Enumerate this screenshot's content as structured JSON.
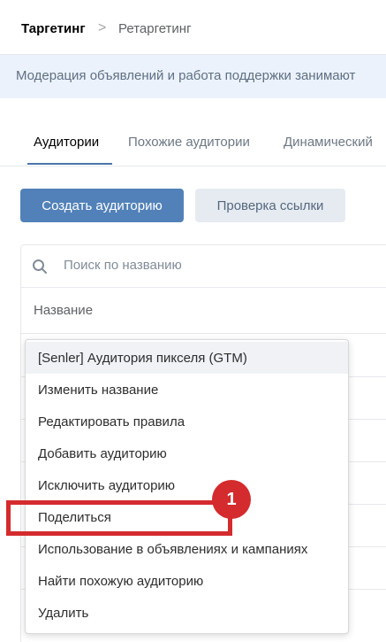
{
  "breadcrumb": {
    "items": [
      "Таргетинг",
      "Ретаргетинг"
    ],
    "separator": ">"
  },
  "notice": {
    "text": "Модерация объявлений и работа поддержки занимают"
  },
  "tabs": [
    {
      "label": "Аудитории",
      "active": true
    },
    {
      "label": "Похожие аудитории",
      "active": false
    },
    {
      "label": "Динамический",
      "active": false
    }
  ],
  "buttons": {
    "create": "Создать аудиторию",
    "check_link": "Проверка ссылки"
  },
  "search": {
    "placeholder": "Поиск по названию",
    "icon": "search-icon"
  },
  "table": {
    "header": "Название"
  },
  "context_menu": {
    "items": [
      "[Senler] Аудитория пикселя (GTM)",
      "Изменить название",
      "Редактировать правила",
      "Добавить аудиторию",
      "Исключить аудиторию",
      "Поделиться",
      "Использование в объявлениях и кампаниях",
      "Найти похожую аудиторию",
      "Удалить"
    ]
  },
  "annotation": {
    "badge": "1",
    "color": "#d42b2e"
  },
  "colors": {
    "primary": "#5181b8",
    "secondary_button": "#e5ebf1",
    "notice_bg": "#ebf2fb",
    "tab_underline": "#4a76a8"
  }
}
